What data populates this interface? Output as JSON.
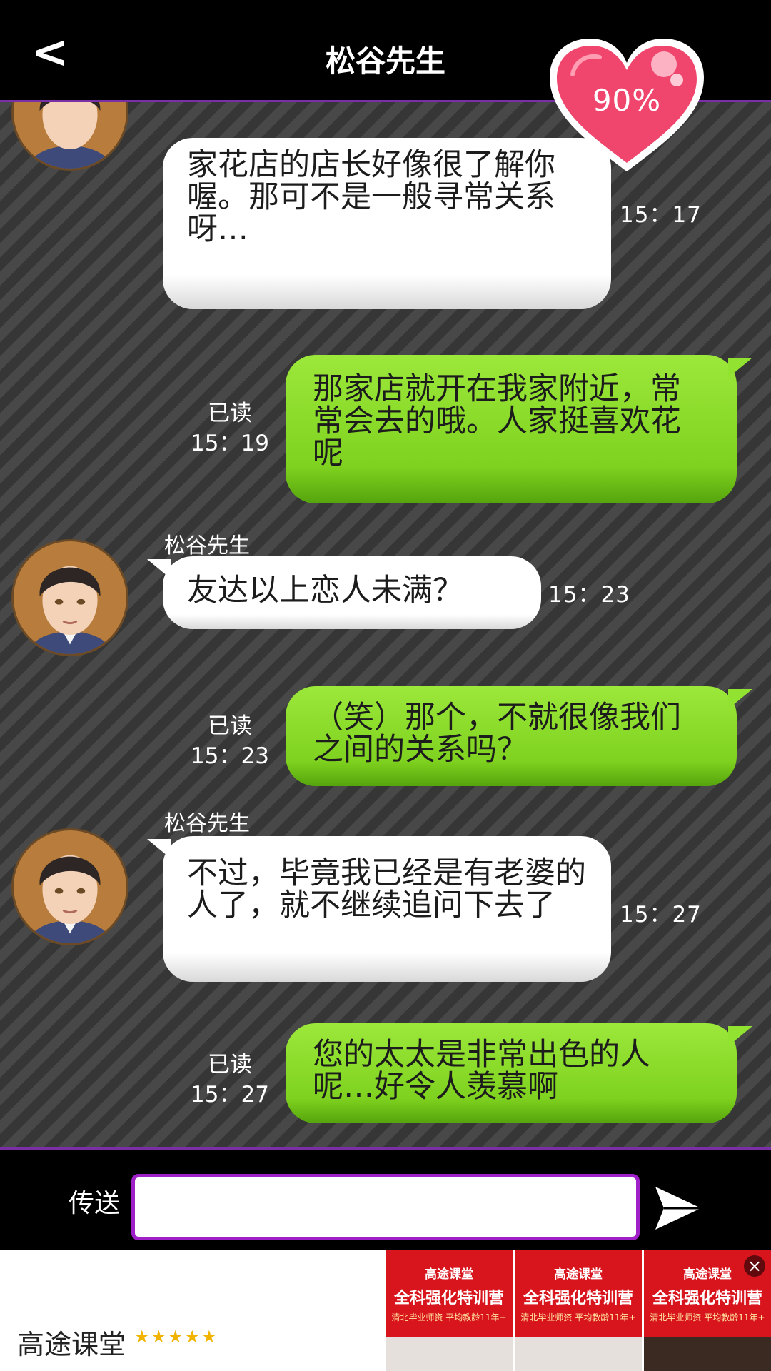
{
  "header": {
    "back_icon": "<",
    "title": "松谷先生",
    "affection": "90%"
  },
  "messages": [
    {
      "type": "in",
      "text": "家花店的店长好像很了解你喔。那可不是一般寻常关系呀…",
      "time": "15：17"
    },
    {
      "type": "out",
      "read": "已读",
      "time": "15：19",
      "text": "那家店就开在我家附近，常常会去的哦。人家挺喜欢花呢"
    },
    {
      "type": "in",
      "sender": "松谷先生",
      "text": "友达以上恋人未满？",
      "time": "15：23"
    },
    {
      "type": "out",
      "read": "已读",
      "time": "15：23",
      "text": "（笑）那个，不就很像我们之间的关系吗？"
    },
    {
      "type": "in",
      "sender": "松谷先生",
      "text": "不过，毕竟我已经是有老婆的人了，就不继续追问下去了",
      "time": "15：27"
    },
    {
      "type": "out",
      "read": "已读",
      "time": "15：27",
      "text": "您的太太是非常出色的人呢…好令人羡慕啊"
    }
  ],
  "inputbar": {
    "send_label": "传送",
    "value": ""
  },
  "ad": {
    "name": "高途课堂",
    "stars": "★★★★★",
    "tiles": [
      {
        "brand": "高途课堂",
        "headline": "全科强化特训营",
        "sub": "清北毕业师资  平均教龄11年+"
      },
      {
        "brand": "高途课堂",
        "headline": "全科强化特训营",
        "sub": "清北毕业师资  平均教龄11年+"
      },
      {
        "brand": "高途课堂",
        "headline": "全科强化特训营",
        "sub": "清北毕业师资  平均教龄11年+"
      }
    ]
  },
  "colors": {
    "accent": "#7b2fa6",
    "input_border": "#a020c8",
    "bubble_out": "#8ad92b",
    "heart": "#f0466e"
  }
}
